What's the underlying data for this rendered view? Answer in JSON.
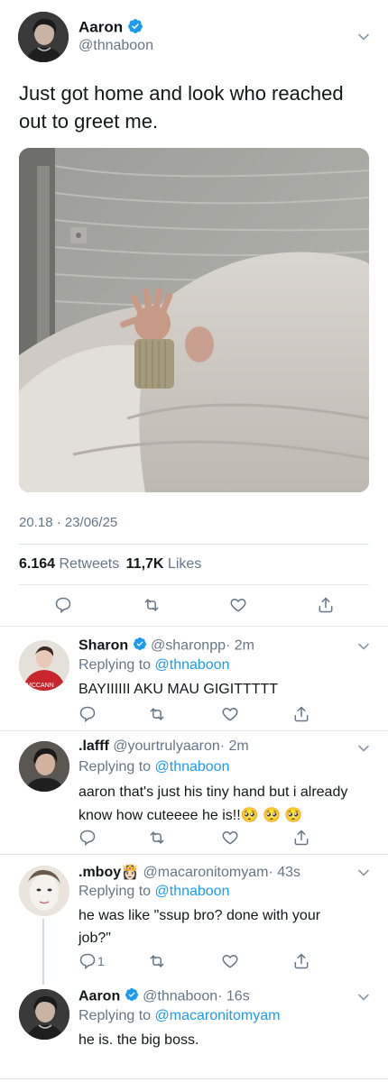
{
  "main_tweet": {
    "author_name": "Aaron",
    "author_handle": "@thnaboon",
    "text_line1": "Just got home and look who reached",
    "text_line2": "out to greet me.",
    "timestamp": "20.18 · 23/06/25",
    "retweets_count": "6.164",
    "retweets_label": "Retweets",
    "likes_count": "11,7K",
    "likes_label": "Likes"
  },
  "replies": [
    {
      "name": "Sharon",
      "handle": "@sharonpp",
      "time": "· 2m",
      "replying_prefix": "Replying to",
      "replying_to": "@thnaboon",
      "text": "BAYIIIIII AKU MAU GIGITTTTT",
      "avatar_badge": "MCCANN"
    },
    {
      "name": ".lafff",
      "handle": "@yourtrulyaaron",
      "time": "· 2m",
      "replying_prefix": "Replying to",
      "replying_to": "@thnaboon",
      "text_line1": "aaron that's just his tiny hand but i already",
      "text_line2": "know how cuteeee he is!!🥺 🥺 🥺"
    },
    {
      "name": ".mboy",
      "name_emoji": "👸🏻",
      "handle": "@macaronitomyam",
      "time": "· 43s",
      "replying_prefix": "Replying to",
      "replying_to": "@thnaboon",
      "text_line1": "he was like \"ssup bro? done with your",
      "text_line2": "job?\"",
      "reply_count": "1"
    },
    {
      "name": "Aaron",
      "handle": "@thnaboon",
      "time": "· 16s",
      "replying_prefix": "Replying to",
      "replying_to": "@macaronitomyam",
      "text": "he is. the big boss."
    }
  ],
  "icons": [
    "reply-icon",
    "retweet-icon",
    "like-icon",
    "share-icon",
    "verified-icon",
    "chevron-down-icon"
  ],
  "colors": {
    "accent": "#1d9bf0",
    "muted": "#657786",
    "divider": "#e1e8ed"
  }
}
